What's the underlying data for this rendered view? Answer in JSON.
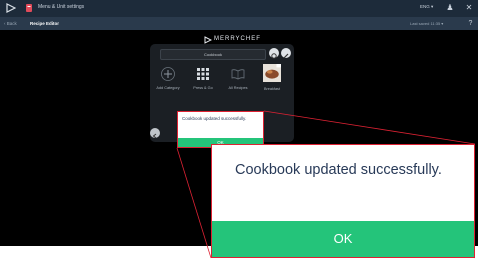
{
  "titlebar": {
    "title": "Menu & Unit settings",
    "user": "ENG ▾",
    "icons": [
      "merrychef-logo-icon",
      "app-icon",
      "user-icon",
      "close-icon"
    ]
  },
  "navbar": {
    "back_label": "‹ Back",
    "heading": "Recipe Editor",
    "right_label": "Last saved 11:35 ▾",
    "icons": [
      "help-icon"
    ]
  },
  "brand": {
    "name": "MERRYCHEF"
  },
  "panel": {
    "cookbook_name": "Cookbook",
    "tiles": [
      {
        "label": "Add Category",
        "icon": "plus-icon"
      },
      {
        "label": "Press & Go",
        "icon": "grid-icon"
      },
      {
        "label": "All Recipes",
        "icon": "book-icon"
      },
      {
        "label": "Breakfast",
        "icon": "food-photo-icon"
      }
    ]
  },
  "dialog": {
    "message": "Cookbook updated successfully.",
    "ok_label": "OK"
  },
  "zoom": {
    "message": "Cookbook updated successfully.",
    "ok_label": "OK"
  },
  "colors": {
    "titlebar": "#1d2b3a",
    "navbar": "#2a3a4c",
    "accent_green": "#24c47a",
    "callout_red": "#dd2233",
    "message_text": "#283a58"
  }
}
